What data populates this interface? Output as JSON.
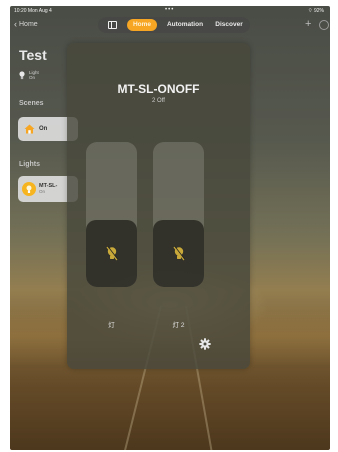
{
  "status_bar": {
    "time_date": "10:20  Mon Aug 4",
    "center": "•••",
    "right": "92%"
  },
  "nav": {
    "back_label": "Home",
    "tabs": [
      {
        "label": "Home",
        "active": true
      },
      {
        "label": "Automation",
        "active": false
      },
      {
        "label": "Discover",
        "active": false
      }
    ],
    "add_icon": "plus-icon",
    "more_icon": "ellipsis-circle-icon"
  },
  "home": {
    "title": "Test",
    "accessory": {
      "name": "Light",
      "state": "On"
    },
    "scenes_header": "Scenes",
    "scene": {
      "label": "On"
    },
    "lights_header": "Lights",
    "light": {
      "name": "MT-SL-",
      "state": "On"
    }
  },
  "modal": {
    "title": "MT-SL-ONOFF",
    "subtitle": "2 Off",
    "switches": [
      {
        "label": "灯",
        "state": "off",
        "level": 0.46
      },
      {
        "label": "灯 2",
        "state": "off",
        "level": 0.46
      }
    ],
    "settings_icon": "gear-icon"
  },
  "colors": {
    "accent": "#f6a623",
    "tile": "#dcdcdc",
    "bulb_on": "#f6b41f",
    "bulb_off": "#c9a93a"
  }
}
